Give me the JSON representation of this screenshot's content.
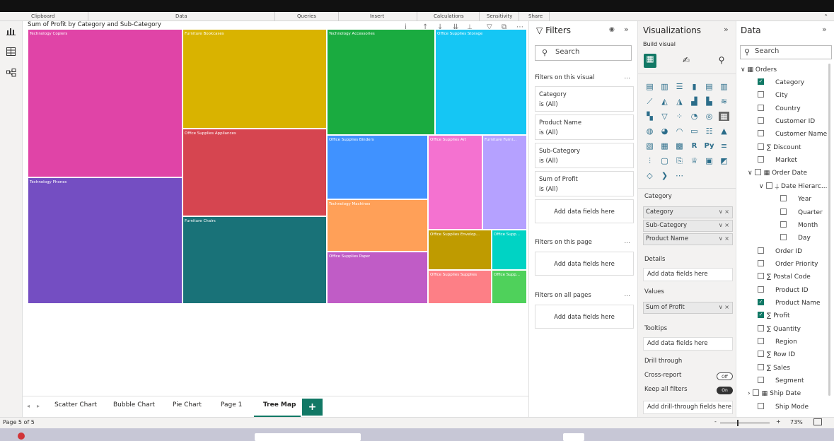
{
  "ribbon": {
    "groups": [
      "Clipboard",
      "Data",
      "Queries",
      "Insert",
      "Calculations",
      "Sensitivity",
      "Share"
    ]
  },
  "visual": {
    "title": "Sum of Profit by Category and Sub-Category",
    "header_icons": [
      "info-icon",
      "drill-up-icon",
      "drill-down-icon",
      "expand-icon",
      "hierarchy-icon",
      "filter-icon",
      "focus-icon",
      "more-icon"
    ]
  },
  "chart_data": {
    "type": "treemap",
    "title": "Sum of Profit by Category and Sub-Category",
    "tiles": [
      {
        "label": "Technology Copiers",
        "color": "#e044a7"
      },
      {
        "label": "Technology Phones",
        "color": "#744ec2"
      },
      {
        "label": "Furniture Bookcases",
        "color": "#d9b300"
      },
      {
        "label": "Office Supplies Appliances",
        "color": "#d64550"
      },
      {
        "label": "Furniture Chairs",
        "color": "#197278"
      },
      {
        "label": "Technology Accessories",
        "color": "#1aab40"
      },
      {
        "label": "Office Supplies Storage",
        "color": "#15c6f4"
      },
      {
        "label": "Office Supplies Binders",
        "color": "#4092ff"
      },
      {
        "label": "Office Supplies Art",
        "color": "#f472d0"
      },
      {
        "label": "Furniture Furni...",
        "color": "#b5a1ff"
      },
      {
        "label": "Technology Machines",
        "color": "#ffa058"
      },
      {
        "label": "Office Supplies Envelop...",
        "color": "#bf9b00"
      },
      {
        "label": "Office Supp...",
        "color": "#00d3c4"
      },
      {
        "label": "Office Supplies Paper",
        "color": "#c05cc6"
      },
      {
        "label": "Office Supplies Supplies",
        "color": "#fd7f86"
      },
      {
        "label": "Office Supp...",
        "color": "#4fd15b"
      }
    ]
  },
  "tabs": {
    "items": [
      "Scatter Chart",
      "Bubble Chart",
      "Pie Chart",
      "Page 1",
      "Tree Map"
    ],
    "active": "Tree Map",
    "add_label": "+"
  },
  "status": {
    "page": "Page 5 of 5",
    "zoom": "73%",
    "zoom_minus": "-",
    "zoom_plus": "+"
  },
  "filters": {
    "title": "Filters",
    "search_placeholder": "Search",
    "on_visual_label": "Filters on this visual",
    "cards": [
      {
        "name": "Category",
        "state": "is (All)"
      },
      {
        "name": "Product Name",
        "state": "is (All)"
      },
      {
        "name": "Sub-Category",
        "state": "is (All)"
      },
      {
        "name": "Sum of Profit",
        "state": "is (All)"
      }
    ],
    "add_fields": "Add data fields here",
    "on_page_label": "Filters on this page",
    "on_all_label": "Filters on all pages",
    "more": "..."
  },
  "visualizations": {
    "title": "Visualizations",
    "build_label": "Build visual",
    "category_label": "Category",
    "category_fields": [
      "Category",
      "Sub-Category",
      "Product Name"
    ],
    "details_label": "Details",
    "values_label": "Values",
    "values_fields": [
      "Sum of Profit"
    ],
    "tooltips_label": "Tooltips",
    "add_fields": "Add data fields here",
    "drill_label": "Drill through",
    "cross_report": "Cross-report",
    "cross_state": "Off",
    "keep_filters": "Keep all filters",
    "keep_state": "On",
    "add_drill": "Add drill-through fields here"
  },
  "data": {
    "title": "Data",
    "search_placeholder": "Search",
    "table": "Orders",
    "fields": [
      {
        "name": "Category",
        "checked": true,
        "sigma": false,
        "indent": 0
      },
      {
        "name": "City",
        "checked": false,
        "sigma": false,
        "indent": 0
      },
      {
        "name": "Country",
        "checked": false,
        "sigma": false,
        "indent": 0
      },
      {
        "name": "Customer ID",
        "checked": false,
        "sigma": false,
        "indent": 0
      },
      {
        "name": "Customer Name",
        "checked": false,
        "sigma": false,
        "indent": 0
      },
      {
        "name": "Discount",
        "checked": false,
        "sigma": true,
        "indent": 0
      },
      {
        "name": "Market",
        "checked": false,
        "sigma": false,
        "indent": 0
      },
      {
        "name": "Order Date",
        "checked": false,
        "sigma": false,
        "indent": 0,
        "expandable": true,
        "calendar": true
      },
      {
        "name": "Date Hierarc...",
        "checked": false,
        "sigma": false,
        "indent": 1,
        "expandable": true,
        "hier": true
      },
      {
        "name": "Year",
        "checked": false,
        "sigma": false,
        "indent": 2
      },
      {
        "name": "Quarter",
        "checked": false,
        "sigma": false,
        "indent": 2
      },
      {
        "name": "Month",
        "checked": false,
        "sigma": false,
        "indent": 2
      },
      {
        "name": "Day",
        "checked": false,
        "sigma": false,
        "indent": 2
      },
      {
        "name": "Order ID",
        "checked": false,
        "sigma": false,
        "indent": 0
      },
      {
        "name": "Order Priority",
        "checked": false,
        "sigma": false,
        "indent": 0
      },
      {
        "name": "Postal Code",
        "checked": false,
        "sigma": true,
        "indent": 0
      },
      {
        "name": "Product ID",
        "checked": false,
        "sigma": false,
        "indent": 0
      },
      {
        "name": "Product Name",
        "checked": true,
        "sigma": false,
        "indent": 0
      },
      {
        "name": "Profit",
        "checked": true,
        "sigma": true,
        "indent": 0
      },
      {
        "name": "Quantity",
        "checked": false,
        "sigma": true,
        "indent": 0
      },
      {
        "name": "Region",
        "checked": false,
        "sigma": false,
        "indent": 0
      },
      {
        "name": "Row ID",
        "checked": false,
        "sigma": true,
        "indent": 0
      },
      {
        "name": "Sales",
        "checked": false,
        "sigma": true,
        "indent": 0
      },
      {
        "name": "Segment",
        "checked": false,
        "sigma": false,
        "indent": 0
      },
      {
        "name": "Ship Date",
        "checked": false,
        "sigma": false,
        "indent": 0,
        "expandable": true,
        "collapsed": true,
        "calendar": true
      },
      {
        "name": "Ship Mode",
        "checked": false,
        "sigma": false,
        "indent": 0
      }
    ]
  }
}
